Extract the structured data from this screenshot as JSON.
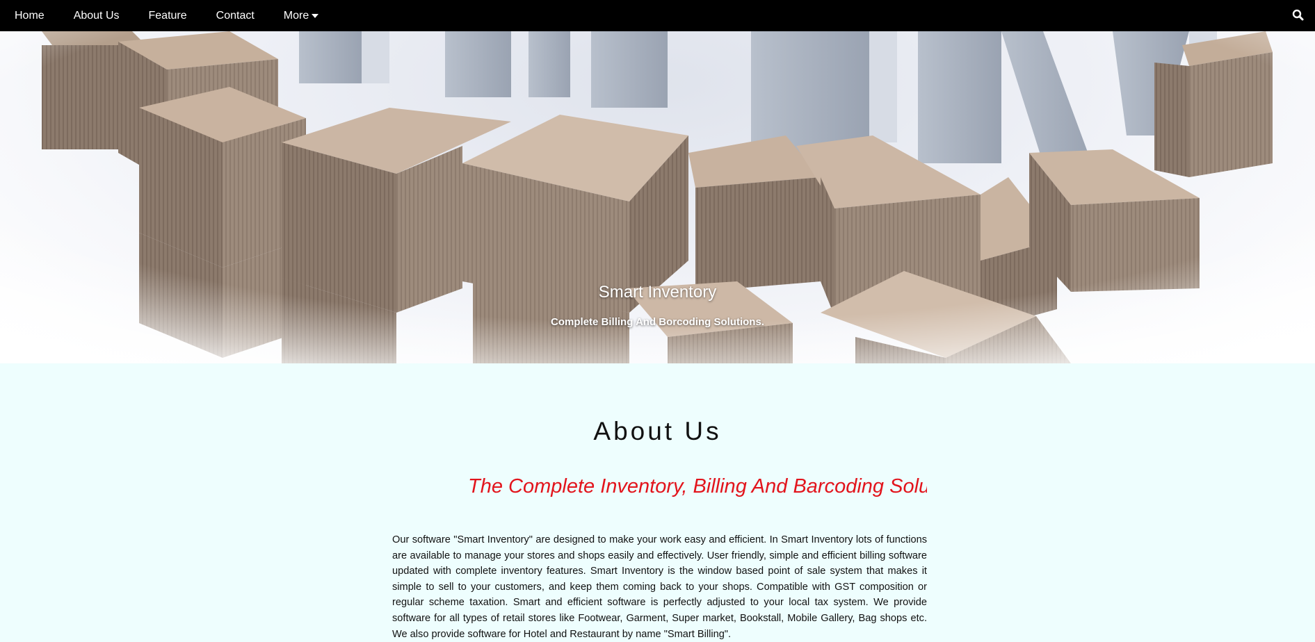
{
  "nav": {
    "items": [
      {
        "label": "Home"
      },
      {
        "label": "About Us"
      },
      {
        "label": "Feature"
      },
      {
        "label": "Contact"
      },
      {
        "label": "More"
      }
    ],
    "search_icon": "search-icon"
  },
  "hero": {
    "title": "Smart Inventory",
    "subtitle": "Complete Billing And Borcoding Solutions."
  },
  "about": {
    "heading": "About Us",
    "tagline": "The Complete Inventory, Billing And Barcoding Solu",
    "body": "Our software \"Smart Inventory\" are designed to make your work easy and efficient. In Smart Inventory lots of functions are available to manage your stores and shops easily and effectively. User friendly, simple and efficient billing software updated with complete inventory features. Smart Inventory is the window based point of sale system that makes it simple to sell to your customers, and keep them coming back to your shops. Compatible with GST composition or regular scheme taxation. Smart and efficient software is perfectly adjusted to your local tax system. We provide software for all types of retail stores like Footwear, Garment, Super market, Bookstall, Mobile Gallery, Bag shops etc. We also provide software for Hotel and Restaurant by name \"Smart Billing\"."
  },
  "colors": {
    "navbar": "#000000",
    "page_background": "#eefefe",
    "tagline": "#e2141c"
  }
}
